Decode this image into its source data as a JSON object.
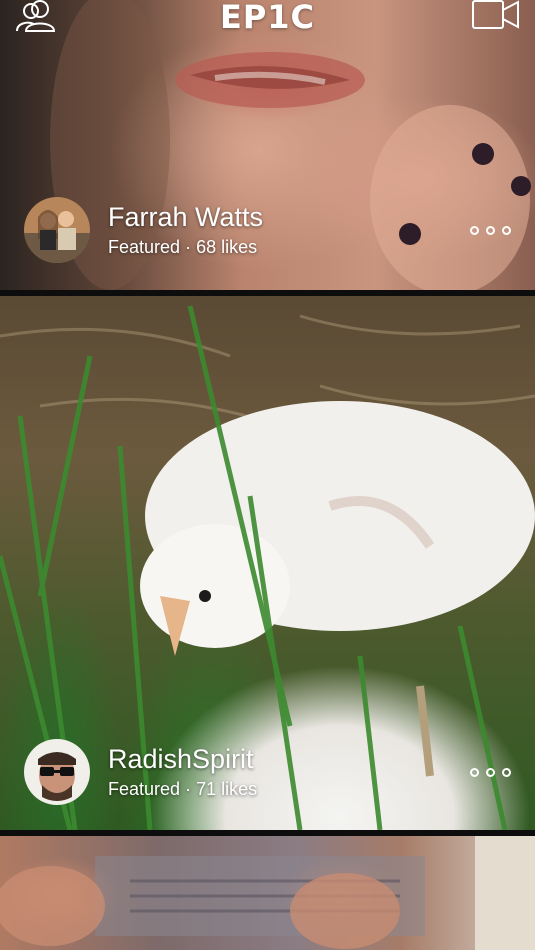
{
  "header": {
    "logo": "EP1C",
    "left_icon": "friends-icon",
    "right_icon": "video-camera-icon"
  },
  "feed": [
    {
      "user": "Farrah Watts",
      "status": "Featured",
      "likes": "68 likes",
      "avatar_icon": "avatar"
    },
    {
      "user": "RadishSpirit",
      "status": "Featured",
      "likes": "71 likes",
      "avatar_icon": "avatar"
    }
  ],
  "more_icon": "more-options-icon",
  "separator": "·"
}
